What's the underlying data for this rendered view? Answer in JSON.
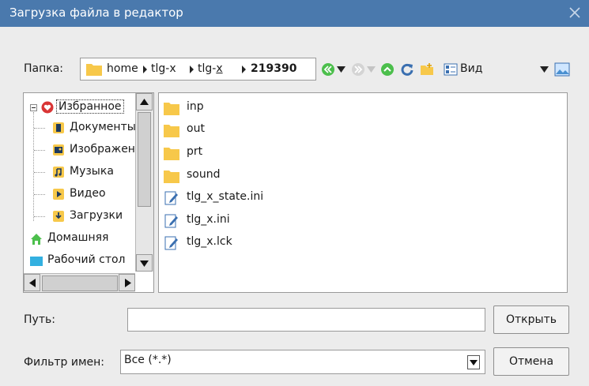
{
  "window": {
    "title": "Загрузка файла в редактор"
  },
  "folder_bar": {
    "label": "Папка:",
    "path": {
      "p1": "home",
      "p2": "tlg-x",
      "p3a": "tlg-",
      "p3b": "x",
      "p4": "219390"
    }
  },
  "toolbar": {
    "view_label": "Вид"
  },
  "tree": {
    "items": [
      {
        "label": "Избранное",
        "icon": "heart-icon"
      },
      {
        "label": "Документы",
        "icon": "documents-icon"
      },
      {
        "label": "Изображения",
        "icon": "images-icon"
      },
      {
        "label": "Музыка",
        "icon": "music-icon"
      },
      {
        "label": "Видео",
        "icon": "video-icon"
      },
      {
        "label": "Загрузки",
        "icon": "download-icon"
      },
      {
        "label": "Домашняя",
        "icon": "home-icon"
      },
      {
        "label": "Рабочий стол",
        "icon": "desktop-icon"
      }
    ]
  },
  "files": [
    {
      "name": "inp",
      "type": "folder"
    },
    {
      "name": "out",
      "type": "folder"
    },
    {
      "name": "prt",
      "type": "folder"
    },
    {
      "name": "sound",
      "type": "folder"
    },
    {
      "name": "tlg_x_state.ini",
      "type": "file"
    },
    {
      "name": "tlg_x.ini",
      "type": "file"
    },
    {
      "name": "tlg_x.lck",
      "type": "file"
    }
  ],
  "path_row": {
    "label": "Путь:",
    "value": "",
    "button": "Открыть"
  },
  "filter_row": {
    "label": "Фильтр имен:",
    "value": "Все (*.*)",
    "button": "Отмена"
  },
  "colors": {
    "titlebar": "#4a79ad",
    "folder": "#f7c84a",
    "accent_green": "#4cbf4c"
  }
}
